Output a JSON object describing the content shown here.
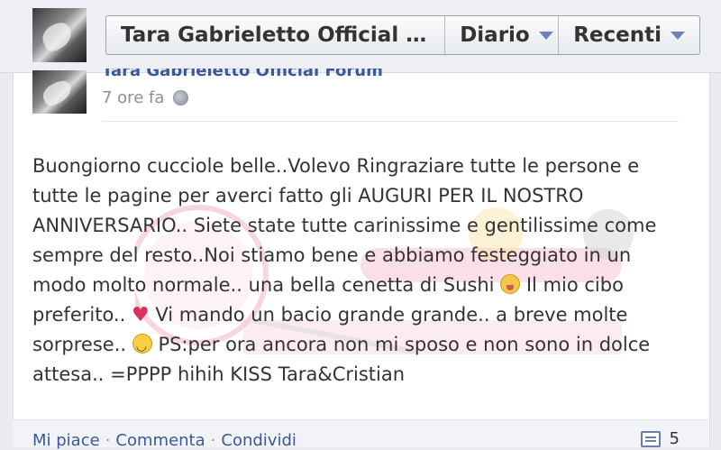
{
  "header": {
    "page_title": "Tara Gabrieletto Official F...",
    "diario_label": "Diario",
    "recenti_label": "Recenti"
  },
  "post": {
    "author": "Tara Gabrieletto Official Forum",
    "time": "7 ore fa",
    "privacy_icon": "globe-icon",
    "text_line1": "Buongiorno cucciole belle..Volevo Ringraziare tutte le persone e",
    "text_line2": "tutte le pagine per averci fatto gli AUGURI PER IL NOSTRO",
    "text_line3": "ANNIVERSARIO.. Siete state tutte carinissime e gentilissime come",
    "text_line4": "sempre del resto..Noi stiamo bene e abbiamo festeggiato in un",
    "text_line5a": "modo molto normale.. una bella cenetta di Sushi",
    "text_line5b": "Il mio cibo",
    "text_line6a": "preferito..",
    "text_line6b": "Vi mando un bacio grande grande.. a breve molte",
    "text_line7a": "sorprese..",
    "text_line7b": "PS:per ora ancora non mi sposo e non sono in dolce",
    "text_line8": "attesa.. =PPPP hihih KISS Tara&Cristian",
    "heart_glyph": "♥"
  },
  "footer": {
    "like_label": "Mi piace",
    "comment_label": "Commenta",
    "share_label": "Condividi",
    "separator": "·",
    "comment_count": "5"
  },
  "colors": {
    "link": "#3b5998",
    "watermark_pink": "#e2709a"
  }
}
